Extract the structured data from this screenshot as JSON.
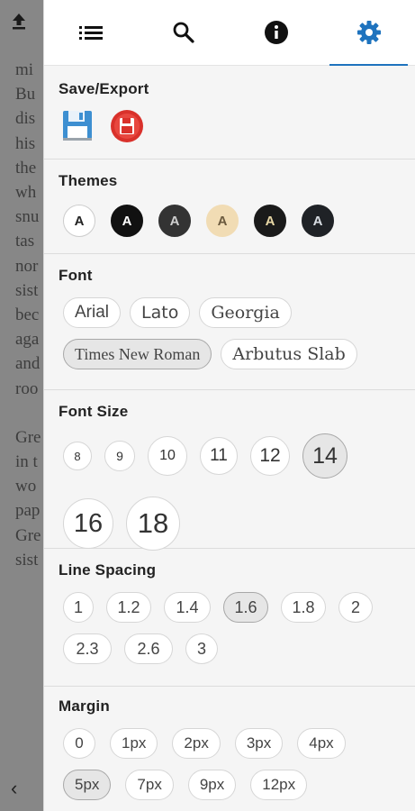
{
  "reader": {
    "lines": [
      "mi",
      "Bu",
      "dis",
      "his",
      "the",
      "wh",
      "snu",
      "tas",
      "nor",
      "sist",
      "bec",
      "aga",
      "and",
      "roo",
      "",
      "Gre",
      "in t",
      "wo",
      "pap",
      "Gre",
      "sist"
    ],
    "back_icon": "‹"
  },
  "tabs": [
    {
      "name": "toc",
      "icon": "list-icon"
    },
    {
      "name": "search",
      "icon": "search-icon"
    },
    {
      "name": "info",
      "icon": "info-icon"
    },
    {
      "name": "settings",
      "icon": "gear-icon",
      "active": true
    }
  ],
  "accent_color": "#1e73be",
  "save": {
    "title": "Save/Export",
    "icons": [
      "floppy-disk-icon",
      "red-save-icon"
    ]
  },
  "themes": {
    "title": "Themes",
    "items": [
      {
        "label": "A",
        "bg": "#ffffff",
        "fg": "#222222",
        "border": "#cccccc"
      },
      {
        "label": "A",
        "bg": "#111111",
        "fg": "#ffffff",
        "border": "#111111"
      },
      {
        "label": "A",
        "bg": "#333333",
        "fg": "#cfcfcf",
        "border": "#333333"
      },
      {
        "label": "A",
        "bg": "#f1dcb4",
        "fg": "#6b5a3e",
        "border": "#f1dcb4"
      },
      {
        "label": "A",
        "bg": "#1a1a1a",
        "fg": "#e9d8a6",
        "border": "#1a1a1a"
      },
      {
        "label": "A",
        "bg": "#1f2226",
        "fg": "#d8dde3",
        "border": "#1f2226"
      }
    ]
  },
  "font": {
    "title": "Font",
    "options": [
      "Arial",
      "Lato",
      "Georgia",
      "Times New Roman",
      "Arbutus Slab"
    ],
    "selected": "Times New Roman"
  },
  "font_size": {
    "title": "Font Size",
    "options": [
      "8",
      "9",
      "10",
      "11",
      "12",
      "14",
      "16",
      "18"
    ],
    "selected": "14"
  },
  "line_spacing": {
    "title": "Line Spacing",
    "options": [
      "1",
      "1.2",
      "1.4",
      "1.6",
      "1.8",
      "2",
      "2.3",
      "2.6",
      "3"
    ],
    "selected": "1.6"
  },
  "margin": {
    "title": "Margin",
    "options": [
      "0",
      "1px",
      "2px",
      "3px",
      "4px",
      "5px",
      "7px",
      "9px",
      "12px"
    ],
    "selected": "5px"
  }
}
